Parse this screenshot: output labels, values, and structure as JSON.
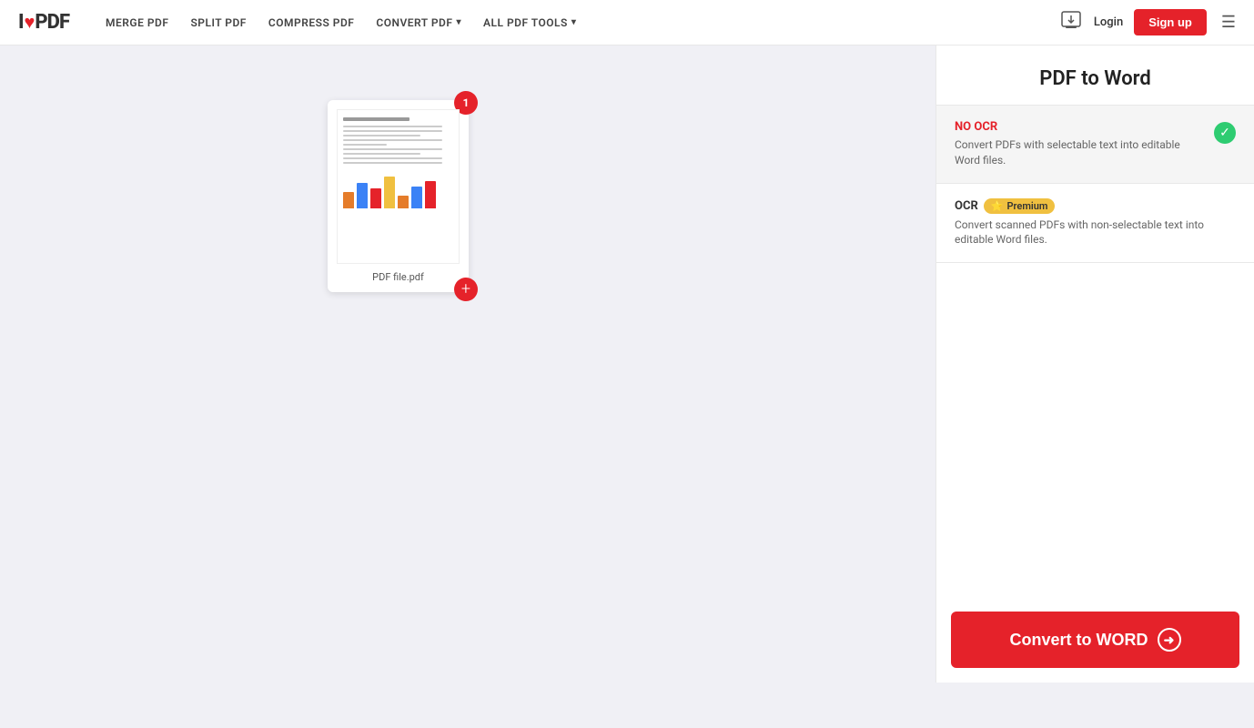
{
  "header": {
    "logo_i": "I",
    "logo_heart": "♥",
    "logo_pdf": "PDF",
    "nav": [
      {
        "label": "MERGE PDF",
        "has_dropdown": false
      },
      {
        "label": "SPLIT PDF",
        "has_dropdown": false
      },
      {
        "label": "COMPRESS PDF",
        "has_dropdown": false
      },
      {
        "label": "CONVERT PDF",
        "has_dropdown": true
      },
      {
        "label": "ALL PDF TOOLS",
        "has_dropdown": true
      }
    ],
    "login_label": "Login",
    "signup_label": "Sign up"
  },
  "main": {
    "pdf_file": {
      "filename": "PDF file.pdf",
      "badge_count": "1"
    }
  },
  "sidebar": {
    "title": "PDF to Word",
    "options": [
      {
        "id": "no_ocr",
        "title": "NO OCR",
        "description": "Convert PDFs with selectable text into editable Word files.",
        "selected": true,
        "premium": false
      },
      {
        "id": "ocr",
        "title": "OCR",
        "description": "Convert scanned PDFs with non-selectable text into editable Word files.",
        "selected": false,
        "premium": true,
        "premium_label": "Premium"
      }
    ],
    "convert_button_label": "Convert to WORD"
  }
}
